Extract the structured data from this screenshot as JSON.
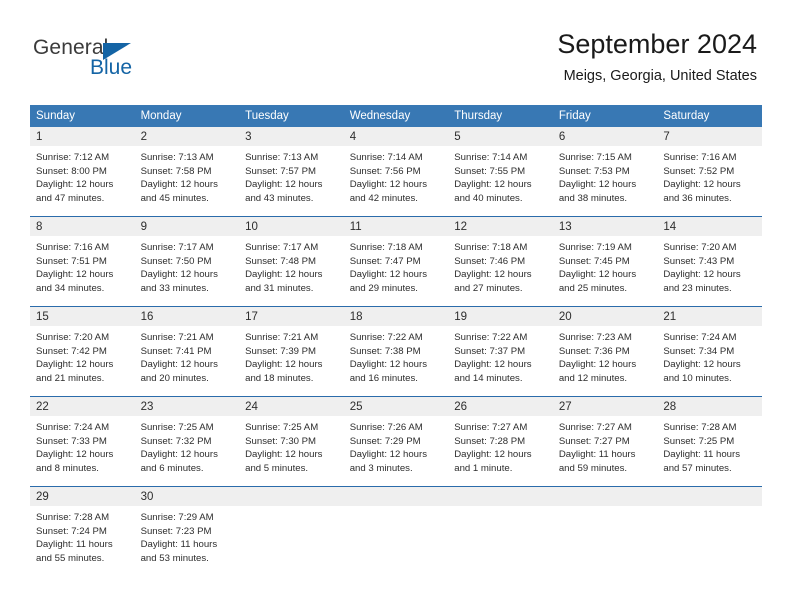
{
  "brand": {
    "name_part1": "General",
    "name_part2": "Blue",
    "logo_icon": "triangle-flag-icon"
  },
  "header": {
    "title": "September 2024",
    "subtitle": "Meigs, Georgia, United States"
  },
  "colors": {
    "header_blue": "#3878b4",
    "row_border_blue": "#2b6cab",
    "daynum_band": "#efefef",
    "brand_blue": "#1464a5"
  },
  "labels": {
    "sunrise_prefix": "Sunrise:",
    "sunset_prefix": "Sunset:",
    "daylight_prefix": "Daylight:"
  },
  "day_headers": [
    "Sunday",
    "Monday",
    "Tuesday",
    "Wednesday",
    "Thursday",
    "Friday",
    "Saturday"
  ],
  "weeks": [
    [
      {
        "day": "1",
        "sunrise": "Sunrise: 7:12 AM",
        "sunset": "Sunset: 8:00 PM",
        "daylight1": "Daylight: 12 hours",
        "daylight2": "and 47 minutes."
      },
      {
        "day": "2",
        "sunrise": "Sunrise: 7:13 AM",
        "sunset": "Sunset: 7:58 PM",
        "daylight1": "Daylight: 12 hours",
        "daylight2": "and 45 minutes."
      },
      {
        "day": "3",
        "sunrise": "Sunrise: 7:13 AM",
        "sunset": "Sunset: 7:57 PM",
        "daylight1": "Daylight: 12 hours",
        "daylight2": "and 43 minutes."
      },
      {
        "day": "4",
        "sunrise": "Sunrise: 7:14 AM",
        "sunset": "Sunset: 7:56 PM",
        "daylight1": "Daylight: 12 hours",
        "daylight2": "and 42 minutes."
      },
      {
        "day": "5",
        "sunrise": "Sunrise: 7:14 AM",
        "sunset": "Sunset: 7:55 PM",
        "daylight1": "Daylight: 12 hours",
        "daylight2": "and 40 minutes."
      },
      {
        "day": "6",
        "sunrise": "Sunrise: 7:15 AM",
        "sunset": "Sunset: 7:53 PM",
        "daylight1": "Daylight: 12 hours",
        "daylight2": "and 38 minutes."
      },
      {
        "day": "7",
        "sunrise": "Sunrise: 7:16 AM",
        "sunset": "Sunset: 7:52 PM",
        "daylight1": "Daylight: 12 hours",
        "daylight2": "and 36 minutes."
      }
    ],
    [
      {
        "day": "8",
        "sunrise": "Sunrise: 7:16 AM",
        "sunset": "Sunset: 7:51 PM",
        "daylight1": "Daylight: 12 hours",
        "daylight2": "and 34 minutes."
      },
      {
        "day": "9",
        "sunrise": "Sunrise: 7:17 AM",
        "sunset": "Sunset: 7:50 PM",
        "daylight1": "Daylight: 12 hours",
        "daylight2": "and 33 minutes."
      },
      {
        "day": "10",
        "sunrise": "Sunrise: 7:17 AM",
        "sunset": "Sunset: 7:48 PM",
        "daylight1": "Daylight: 12 hours",
        "daylight2": "and 31 minutes."
      },
      {
        "day": "11",
        "sunrise": "Sunrise: 7:18 AM",
        "sunset": "Sunset: 7:47 PM",
        "daylight1": "Daylight: 12 hours",
        "daylight2": "and 29 minutes."
      },
      {
        "day": "12",
        "sunrise": "Sunrise: 7:18 AM",
        "sunset": "Sunset: 7:46 PM",
        "daylight1": "Daylight: 12 hours",
        "daylight2": "and 27 minutes."
      },
      {
        "day": "13",
        "sunrise": "Sunrise: 7:19 AM",
        "sunset": "Sunset: 7:45 PM",
        "daylight1": "Daylight: 12 hours",
        "daylight2": "and 25 minutes."
      },
      {
        "day": "14",
        "sunrise": "Sunrise: 7:20 AM",
        "sunset": "Sunset: 7:43 PM",
        "daylight1": "Daylight: 12 hours",
        "daylight2": "and 23 minutes."
      }
    ],
    [
      {
        "day": "15",
        "sunrise": "Sunrise: 7:20 AM",
        "sunset": "Sunset: 7:42 PM",
        "daylight1": "Daylight: 12 hours",
        "daylight2": "and 21 minutes."
      },
      {
        "day": "16",
        "sunrise": "Sunrise: 7:21 AM",
        "sunset": "Sunset: 7:41 PM",
        "daylight1": "Daylight: 12 hours",
        "daylight2": "and 20 minutes."
      },
      {
        "day": "17",
        "sunrise": "Sunrise: 7:21 AM",
        "sunset": "Sunset: 7:39 PM",
        "daylight1": "Daylight: 12 hours",
        "daylight2": "and 18 minutes."
      },
      {
        "day": "18",
        "sunrise": "Sunrise: 7:22 AM",
        "sunset": "Sunset: 7:38 PM",
        "daylight1": "Daylight: 12 hours",
        "daylight2": "and 16 minutes."
      },
      {
        "day": "19",
        "sunrise": "Sunrise: 7:22 AM",
        "sunset": "Sunset: 7:37 PM",
        "daylight1": "Daylight: 12 hours",
        "daylight2": "and 14 minutes."
      },
      {
        "day": "20",
        "sunrise": "Sunrise: 7:23 AM",
        "sunset": "Sunset: 7:36 PM",
        "daylight1": "Daylight: 12 hours",
        "daylight2": "and 12 minutes."
      },
      {
        "day": "21",
        "sunrise": "Sunrise: 7:24 AM",
        "sunset": "Sunset: 7:34 PM",
        "daylight1": "Daylight: 12 hours",
        "daylight2": "and 10 minutes."
      }
    ],
    [
      {
        "day": "22",
        "sunrise": "Sunrise: 7:24 AM",
        "sunset": "Sunset: 7:33 PM",
        "daylight1": "Daylight: 12 hours",
        "daylight2": "and 8 minutes."
      },
      {
        "day": "23",
        "sunrise": "Sunrise: 7:25 AM",
        "sunset": "Sunset: 7:32 PM",
        "daylight1": "Daylight: 12 hours",
        "daylight2": "and 6 minutes."
      },
      {
        "day": "24",
        "sunrise": "Sunrise: 7:25 AM",
        "sunset": "Sunset: 7:30 PM",
        "daylight1": "Daylight: 12 hours",
        "daylight2": "and 5 minutes."
      },
      {
        "day": "25",
        "sunrise": "Sunrise: 7:26 AM",
        "sunset": "Sunset: 7:29 PM",
        "daylight1": "Daylight: 12 hours",
        "daylight2": "and 3 minutes."
      },
      {
        "day": "26",
        "sunrise": "Sunrise: 7:27 AM",
        "sunset": "Sunset: 7:28 PM",
        "daylight1": "Daylight: 12 hours",
        "daylight2": "and 1 minute."
      },
      {
        "day": "27",
        "sunrise": "Sunrise: 7:27 AM",
        "sunset": "Sunset: 7:27 PM",
        "daylight1": "Daylight: 11 hours",
        "daylight2": "and 59 minutes."
      },
      {
        "day": "28",
        "sunrise": "Sunrise: 7:28 AM",
        "sunset": "Sunset: 7:25 PM",
        "daylight1": "Daylight: 11 hours",
        "daylight2": "and 57 minutes."
      }
    ],
    [
      {
        "day": "29",
        "sunrise": "Sunrise: 7:28 AM",
        "sunset": "Sunset: 7:24 PM",
        "daylight1": "Daylight: 11 hours",
        "daylight2": "and 55 minutes."
      },
      {
        "day": "30",
        "sunrise": "Sunrise: 7:29 AM",
        "sunset": "Sunset: 7:23 PM",
        "daylight1": "Daylight: 11 hours",
        "daylight2": "and 53 minutes."
      },
      {
        "day": "",
        "sunrise": "",
        "sunset": "",
        "daylight1": "",
        "daylight2": ""
      },
      {
        "day": "",
        "sunrise": "",
        "sunset": "",
        "daylight1": "",
        "daylight2": ""
      },
      {
        "day": "",
        "sunrise": "",
        "sunset": "",
        "daylight1": "",
        "daylight2": ""
      },
      {
        "day": "",
        "sunrise": "",
        "sunset": "",
        "daylight1": "",
        "daylight2": ""
      },
      {
        "day": "",
        "sunrise": "",
        "sunset": "",
        "daylight1": "",
        "daylight2": ""
      }
    ]
  ]
}
